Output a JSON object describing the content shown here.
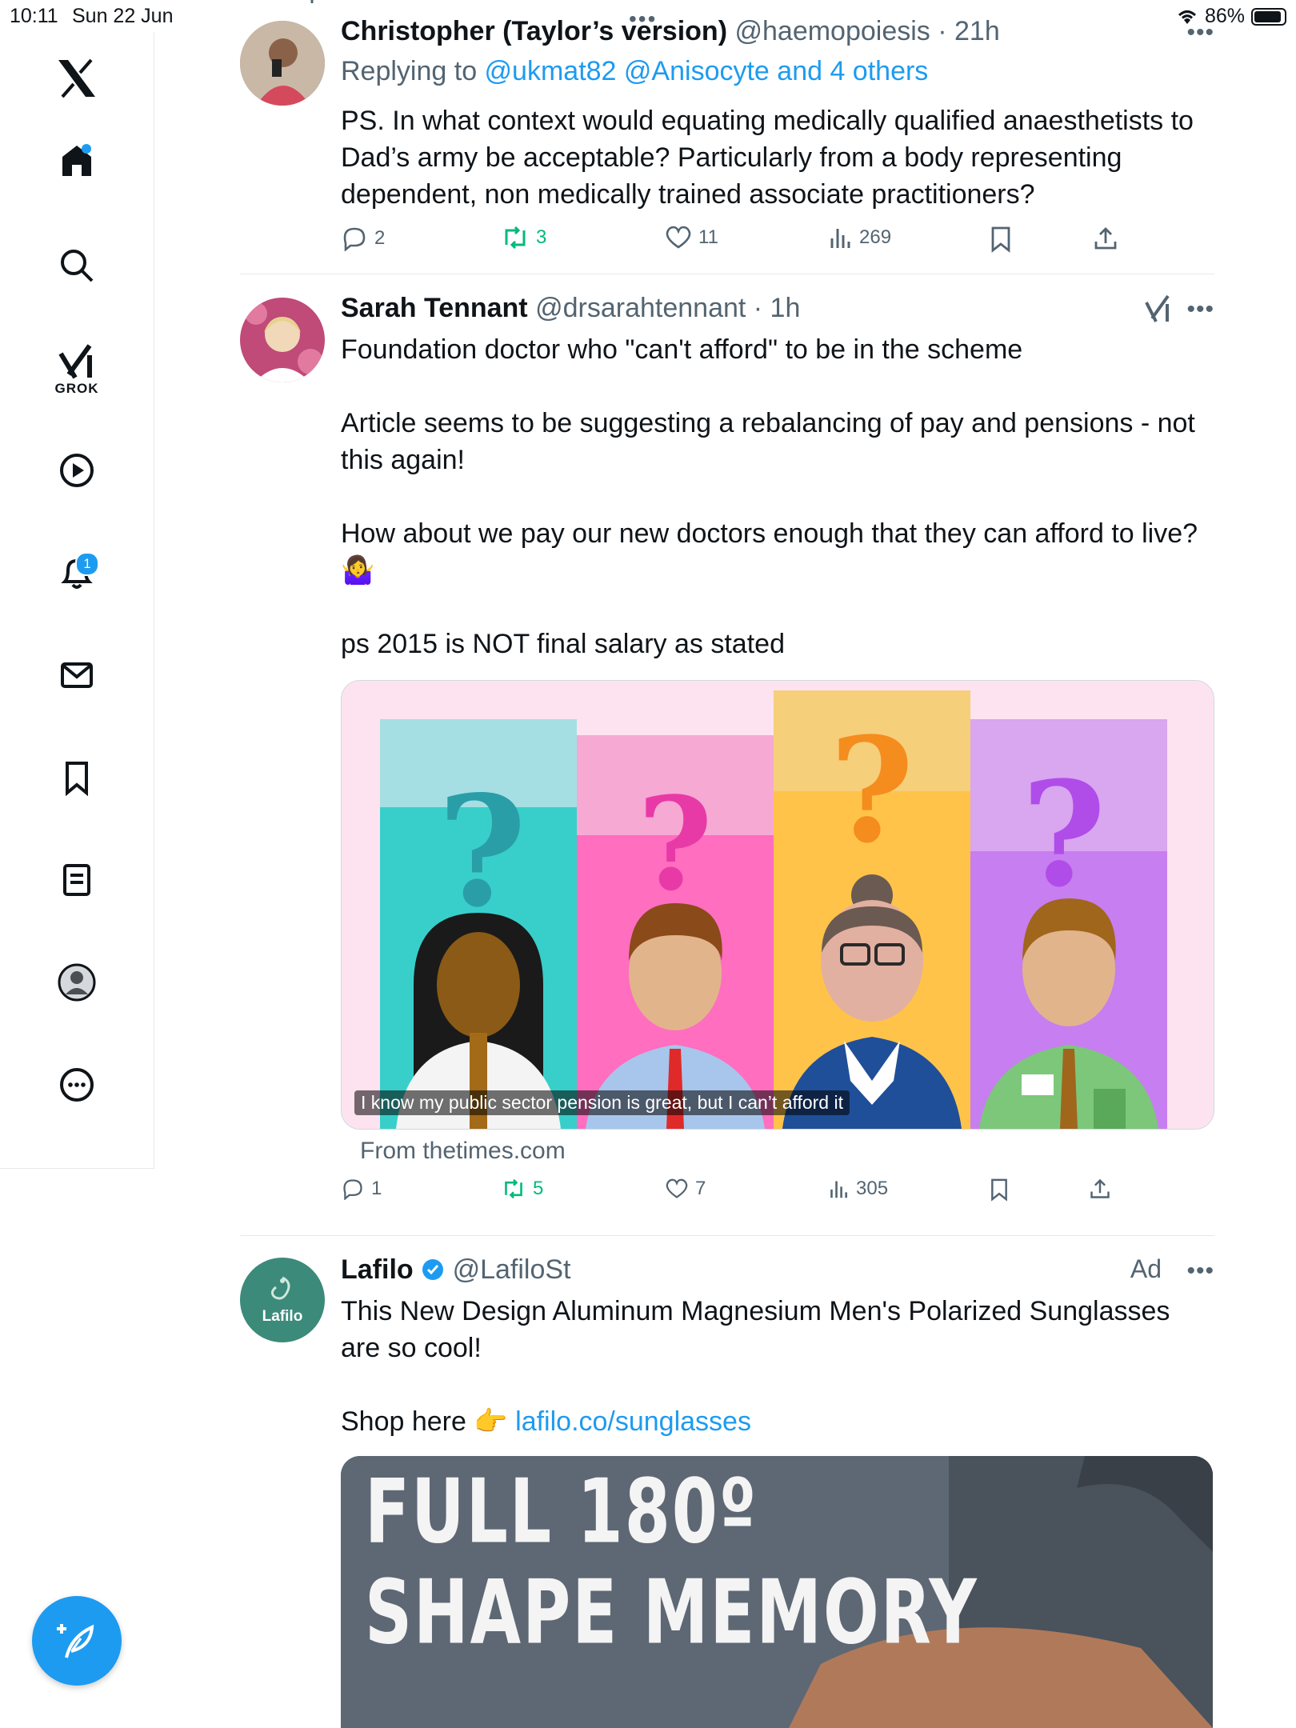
{
  "status_bar": {
    "time": "10:11",
    "date": "Sun 22 Jun",
    "battery": "86%"
  },
  "sidebar": {
    "grok_label": "GROK",
    "notifications_badge": "1"
  },
  "posts": [
    {
      "name": "Christopher (Taylor’s version)",
      "handle": "@haemopoiesis",
      "time": "· 21h",
      "reply_prefix": "Replying to ",
      "reply_to": "@ukmat82 @Anisocyte and 4 others",
      "text": "PS. In what context would equating medically qualified anaesthetists to Dad’s army be acceptable? Particularly from a body representing dependent, non medically trained associate practitioners?",
      "replies": "2",
      "reposts": "3",
      "likes": "11",
      "views": "269"
    },
    {
      "name": "Sarah Tennant",
      "handle": "@drsarahtennant",
      "time": "· 1h",
      "paragraphs": [
        "Foundation doctor who \"can't afford\" to be in the scheme",
        "Article seems to be suggesting a rebalancing of pay and pensions - not this again!",
        "How about we pay our new doctors enough that they can afford to live?",
        "🤷‍♀️",
        "ps 2015 is NOT final salary as stated"
      ],
      "image_caption": "I know my public sector pension is great, but I can’t afford it",
      "source": "From thetimes.com",
      "replies": "1",
      "reposts": "5",
      "likes": "7",
      "views": "305"
    },
    {
      "name": "Lafilo",
      "handle": "@LafiloSt",
      "ad_label": "Ad",
      "avatar_text": "Lafilo",
      "text": "This New Design Aluminum Magnesium Men's Polarized Sunglasses are so cool!",
      "shop_prefix": "Shop here 👉 ",
      "shop_link": "lafilo.co/sunglasses",
      "image_lines": [
        "FULL 180º",
        "SHAPE MEMORY"
      ]
    }
  ],
  "colors": {
    "accent": "#1d9bf0",
    "repost": "#00ba7c",
    "muted": "#536471"
  }
}
